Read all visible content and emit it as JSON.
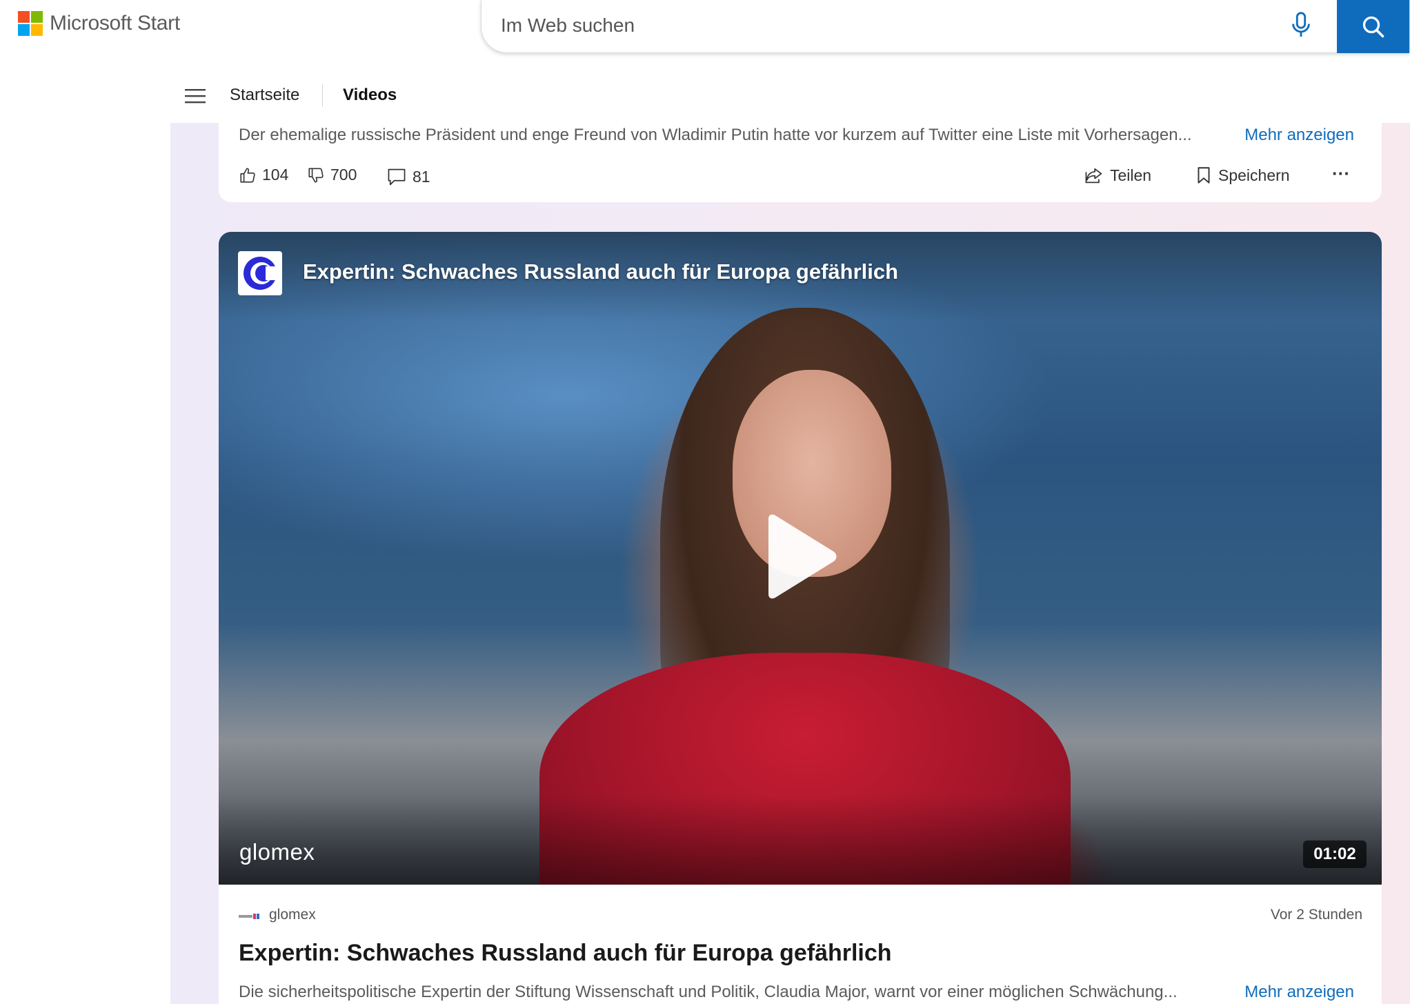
{
  "header": {
    "brand_name": "Microsoft Start",
    "search_placeholder": "Im Web suchen",
    "logo_colors": [
      "#f25022",
      "#7fba00",
      "#00a4ef",
      "#ffb900"
    ],
    "accent_color": "#0f6cbd"
  },
  "nav": {
    "items": [
      {
        "label": "Startseite",
        "active": false
      },
      {
        "label": "Videos",
        "active": true
      }
    ]
  },
  "top_card": {
    "description": "Der ehemalige russische Präsident und enge Freund von Wladimir Putin hatte vor kurzem auf Twitter eine Liste mit Vorhersagen...",
    "more_label": "Mehr anzeigen",
    "likes": "104",
    "dislikes": "700",
    "comments": "81",
    "share_label": "Teilen",
    "save_label": "Speichern",
    "more_options": "···"
  },
  "video_card": {
    "overlay_title": "Expertin: Schwaches Russland auch für Europa gefährlich",
    "brand_watermark": "glomex",
    "duration": "01:02",
    "source_name": "glomex",
    "time_ago": "Vor 2 Stunden",
    "title": "Expertin: Schwaches Russland auch für Europa gefährlich",
    "description": "Die sicherheitspolitische Expertin der Stiftung Wissenschaft und Politik, Claudia Major, warnt vor einer möglichen Schwächung...",
    "more_label": "Mehr anzeigen"
  }
}
